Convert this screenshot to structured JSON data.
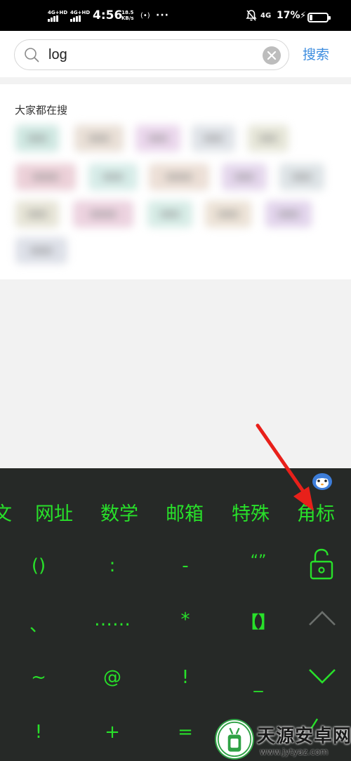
{
  "status_bar": {
    "sim1": "4G+HD",
    "sim2": "4G+HD",
    "time": "4:56",
    "speed_value": "18.5",
    "speed_unit": "KB/s",
    "hotspot": "(•)",
    "more": "···",
    "network": "4G",
    "battery_percent": "17%",
    "battery_level": 0.17
  },
  "search": {
    "query": "log",
    "submit_label": "搜索"
  },
  "hot": {
    "title": "大家都在搜",
    "chip_colors": [
      "#cfe8e2",
      "#e9dfd6",
      "#ead6ec",
      "#dfe3e8",
      "#e6e6d8",
      "#ecd0d8",
      "#d6ece8",
      "#ecdfd6",
      "#e4d6ec",
      "#dde3e6",
      "#e6e4d6",
      "#ecd2df",
      "#d6ece6",
      "#ece2d6",
      "#e2d4ec",
      "#dde0e8"
    ]
  },
  "keyboard": {
    "categories": [
      "文",
      "网址",
      "数学",
      "邮箱",
      "特殊",
      "角标"
    ],
    "keys": [
      "()",
      ":",
      "-",
      "“”",
      "、",
      "……",
      "*",
      "【】",
      "~",
      "@",
      "!",
      "_",
      "!",
      "+",
      "="
    ],
    "icons": [
      "lock-open-icon",
      "arrow-up-icon",
      "arrow-down-icon",
      "enter-icon"
    ],
    "accent_color": "#28e02a",
    "background": "#262927"
  },
  "annotation": {
    "arrow_color": "#e8201a"
  },
  "watermark": {
    "title": "天源安卓网",
    "url": "www.jytyaz.com"
  }
}
